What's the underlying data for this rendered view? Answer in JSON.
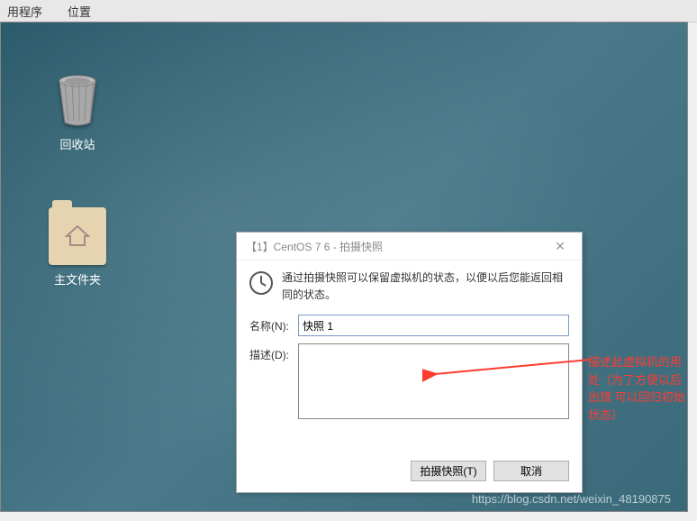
{
  "menubar": {
    "items": [
      "用程序",
      "位置"
    ]
  },
  "desktop": {
    "icons": {
      "trash": {
        "label": "回收站"
      },
      "home": {
        "label": "主文件夹"
      }
    }
  },
  "dialog": {
    "title": "【1】CentOS 7 6 - 拍摄快照",
    "info": "通过拍摄快照可以保留虚拟机的状态，以便以后您能返回相同的状态。",
    "name_label": "名称(N):",
    "name_value": "快照 1",
    "desc_label": "描述(D):",
    "desc_value": "",
    "btn_take": "拍摄快照(T)",
    "btn_cancel": "取消"
  },
  "annotation": "描述此虚拟机的用处（为了方便以后出错  可以回归初始状态）",
  "watermark": "https://blog.csdn.net/weixin_48190875"
}
